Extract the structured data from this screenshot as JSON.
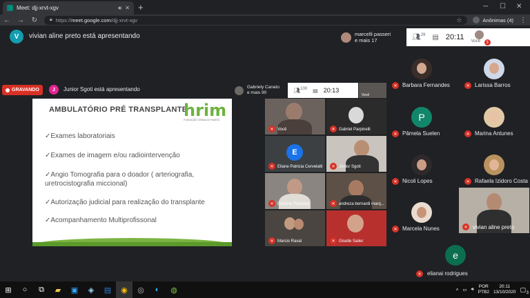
{
  "browser": {
    "tab_title": "Meet: djj-xrvt-xgv",
    "new_tab": "+",
    "url_proto": "https://",
    "url_host": "meet.google.com",
    "url_path": "/djj-xrvt-xgv",
    "profile_label": "Anônimas (4)"
  },
  "presenter_banner": {
    "initial": "V",
    "text": "vivian aline preto está apresentando",
    "color": "#129eaf"
  },
  "top_info": {
    "name_line1": "marcelli passeri",
    "name_line2": "e mais 17",
    "people_count": "29",
    "clock": "20:11",
    "self_label": "Você",
    "self_badge": "3"
  },
  "inner": {
    "recording_label": "GRAVANDO",
    "presenter_initial": "J",
    "presenter_text": "Junior Sgoti está apresentando",
    "info_name_line1": "Gabriely Canato",
    "info_name_line2": "e mais 90",
    "people_count": "100",
    "clock": "20:13",
    "self_label": "Você"
  },
  "slide": {
    "title": "AMBULATÓRIO PRÉ TRANSPLANTE",
    "logo_text": "hrim",
    "logo_sub": "FUNDAÇÃO OSWALDO RAMOS",
    "bullets": [
      "✓Exames laboratoriais",
      "✓Exames de imagem e/ou radiointervenção",
      "✓Angio Tomografia para o doador ( arteriografia, uretrocistografia miccional)",
      "✓Autorização judicial para realização do transplante",
      "✓Acompanhamento Multiprofissonal"
    ]
  },
  "inner_tiles": [
    "Você",
    "Gabriel Parpinelli",
    "Eliane Patricia Cervelatti",
    "Junior Sgoti",
    "Edilaine Padoves",
    "andreza bernardi marq...",
    "Marcio Raval",
    "Giselle Sailer"
  ],
  "participants": [
    {
      "name": "Barbara Fernandes"
    },
    {
      "name": "Larissa Barros"
    },
    {
      "name": "Pâmela Suelen",
      "initial": "P"
    },
    {
      "name": "Marina Antunes"
    },
    {
      "name": "Nicoli Lopes"
    },
    {
      "name": "Rafaela Izidoro Costa"
    },
    {
      "name": "Marcela Nunes"
    },
    {
      "name": "vivian aline preto"
    },
    {
      "name": "elianai rodrigues",
      "initial": "e"
    }
  ],
  "eliane_initial": "E",
  "taskbar": {
    "lang1": "POR",
    "lang2": "PTB2",
    "time": "20:11",
    "date": "13/10/2020",
    "notif": "3"
  }
}
